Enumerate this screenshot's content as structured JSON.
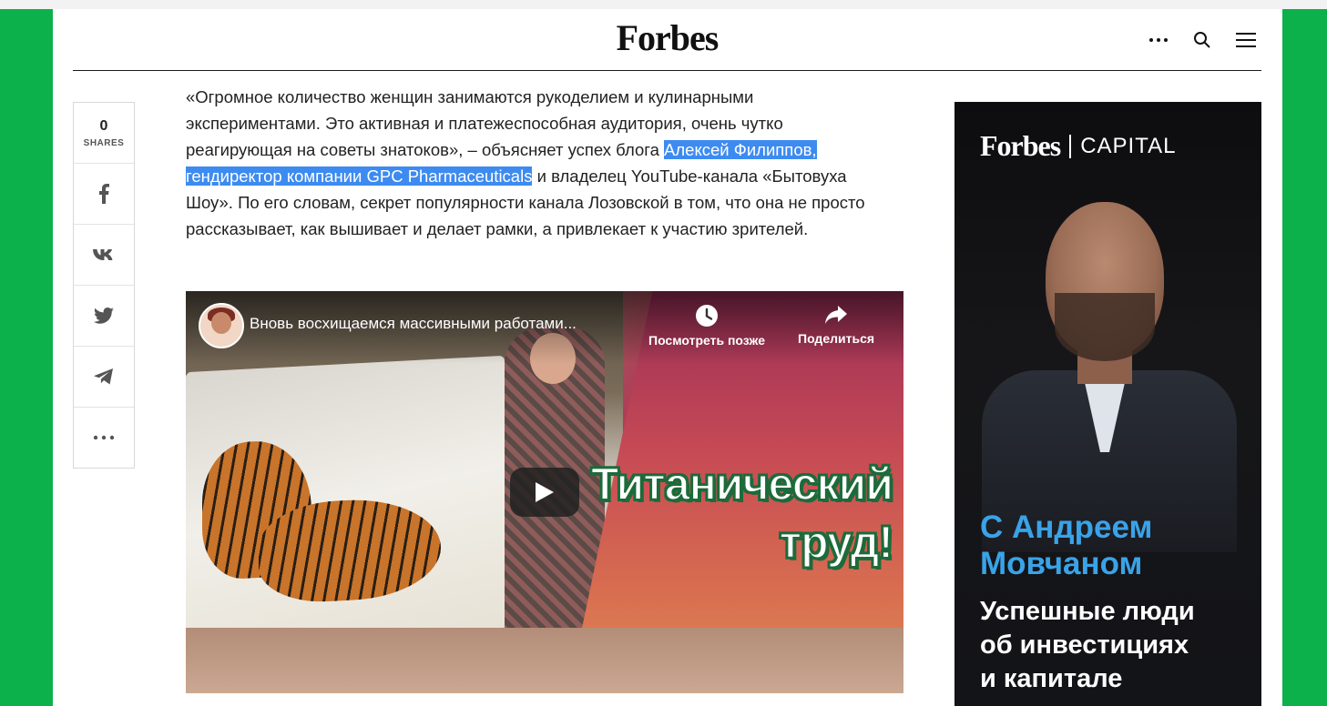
{
  "header": {
    "logo": "Forbes",
    "icons": [
      "more-icon",
      "search-icon",
      "menu-icon"
    ]
  },
  "share": {
    "count": "0",
    "count_label": "SHARES",
    "buttons": [
      "facebook-icon",
      "vk-icon",
      "twitter-icon",
      "telegram-icon",
      "more-icon"
    ]
  },
  "article": {
    "text_before": "«Огромное количество женщин занимаются рукоделием и кулинарными экспериментами. Это активная и платежеспособная аудитория, очень чутко реагирующая на советы знатоков», – объясняет успех блога ",
    "text_highlight": "Алексей Филиппов, гендиректор компании GPC Pharmaceuticals",
    "text_after": " и владелец YouTube-канала «Бытовуха Шоу». По его словам, секрет популярности канала Лозовской в том, что она не просто рассказывает, как вышивает и делает рамки, а привлекает к участию зрителей."
  },
  "video": {
    "title": "Вновь восхищаемся массивными работами...",
    "watch_later": "Посмотреть позже",
    "share": "Поделиться",
    "thumb_line1": "Титанический",
    "thumb_line2": "труд!"
  },
  "ad": {
    "logo_brand": "Forbes",
    "logo_section": "CAPITAL",
    "headline_line1": "С Андреем",
    "headline_line2": "Мовчаном",
    "sub_line1": "Успешные люди",
    "sub_line2": "об инвестициях",
    "sub_line3": "и капитале"
  },
  "colors": {
    "background": "#0cb14b",
    "highlight": "#3d8bf0",
    "ad_accent": "#3aa3e8"
  }
}
